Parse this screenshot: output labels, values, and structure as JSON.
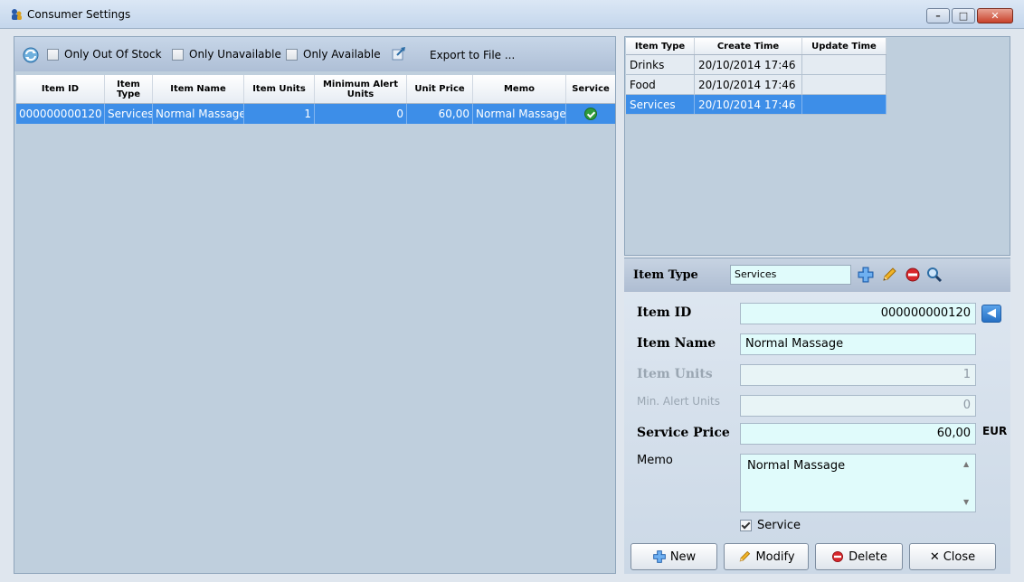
{
  "window": {
    "title": "Consumer Settings",
    "minimize_glyph": "–",
    "maximize_glyph": "□",
    "close_glyph": "✕"
  },
  "toolbar": {
    "only_out_of_stock": "Only Out Of Stock",
    "only_unavailable": "Only Unavailable",
    "only_available": "Only Available",
    "export_label": "Export to File ..."
  },
  "items_grid": {
    "headers": [
      "Item ID",
      "Item Type",
      "Item Name",
      "Item Units",
      "Minimum Alert Units",
      "Unit Price",
      "Memo",
      "Service"
    ],
    "rows": [
      {
        "item_id": "000000000120",
        "item_type": "Services",
        "item_name": "Normal Massage",
        "item_units": "1",
        "min_alert_units": "0",
        "unit_price": "60,00",
        "memo": "Normal Massage",
        "service": true
      }
    ]
  },
  "types_grid": {
    "headers": [
      "Item Type",
      "Create Time",
      "Update Time"
    ],
    "rows": [
      {
        "type": "Drinks",
        "create": "20/10/2014 17:46",
        "update": ""
      },
      {
        "type": "Food",
        "create": "20/10/2014 17:46",
        "update": ""
      },
      {
        "type": "Services",
        "create": "20/10/2014 17:46",
        "update": "",
        "selected": true
      }
    ]
  },
  "item_type_bar": {
    "label": "Item Type",
    "value": "Services"
  },
  "form": {
    "item_id_label": "Item ID",
    "item_id_value": "000000000120",
    "item_name_label": "Item Name",
    "item_name_value": "Normal Massage",
    "item_units_label": "Item Units",
    "item_units_value": "1",
    "min_alert_label": "Min. Alert Units",
    "min_alert_value": "0",
    "service_price_label": "Service Price",
    "service_price_value": "60,00",
    "currency": "EUR",
    "memo_label": "Memo",
    "memo_value": "Normal Massage",
    "service_checkbox_label": "Service",
    "service_checked": true
  },
  "buttons": {
    "new": "New",
    "modify": "Modify",
    "delete": "Delete",
    "close": "Close"
  },
  "colors": {
    "selection": "#3d8ee8",
    "panel": "#bfcfdd",
    "input_bg": "#e0fbfb"
  }
}
